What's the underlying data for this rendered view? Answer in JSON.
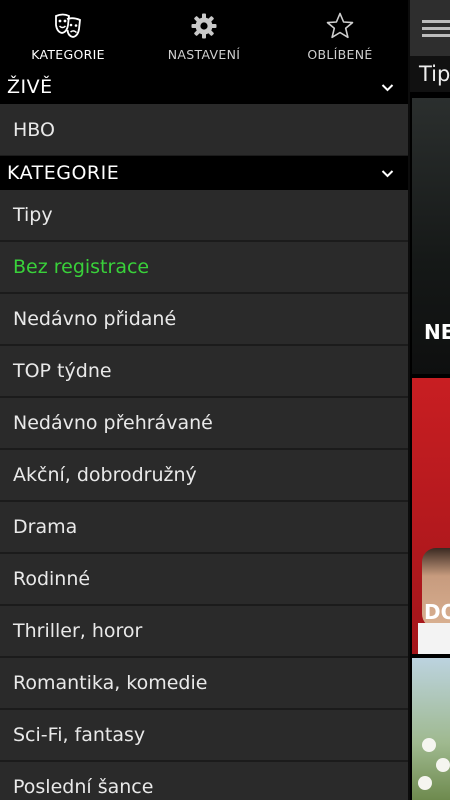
{
  "tabs": [
    {
      "label": "KATEGORIE",
      "icon": "theater-masks-icon",
      "active": true
    },
    {
      "label": "NASTAVENÍ",
      "icon": "gear-icon",
      "active": false
    },
    {
      "label": "OBLÍBENÉ",
      "icon": "star-icon",
      "active": false
    }
  ],
  "sections": {
    "live": {
      "title": "ŽIVĚ",
      "items": [
        "HBO"
      ]
    },
    "categories": {
      "title": "KATEGORIE",
      "items": [
        "Tipy",
        "Bez registrace",
        "Nedávno přidané",
        "TOP týdne",
        "Nedávno přehrávané",
        "Akční, dobrodružný",
        "Drama",
        "Rodinné",
        "Thriller, horor",
        "Romantika, komedie",
        "Sci-Fi, fantasy",
        "Poslední šance"
      ]
    }
  },
  "background": {
    "section_label": "Tip",
    "tile_1_text": "NE",
    "tile_2_text": "DO"
  },
  "colors": {
    "accent": "#39d13a",
    "item_bg": "#2a2a2a",
    "header_bg": "#000000"
  }
}
